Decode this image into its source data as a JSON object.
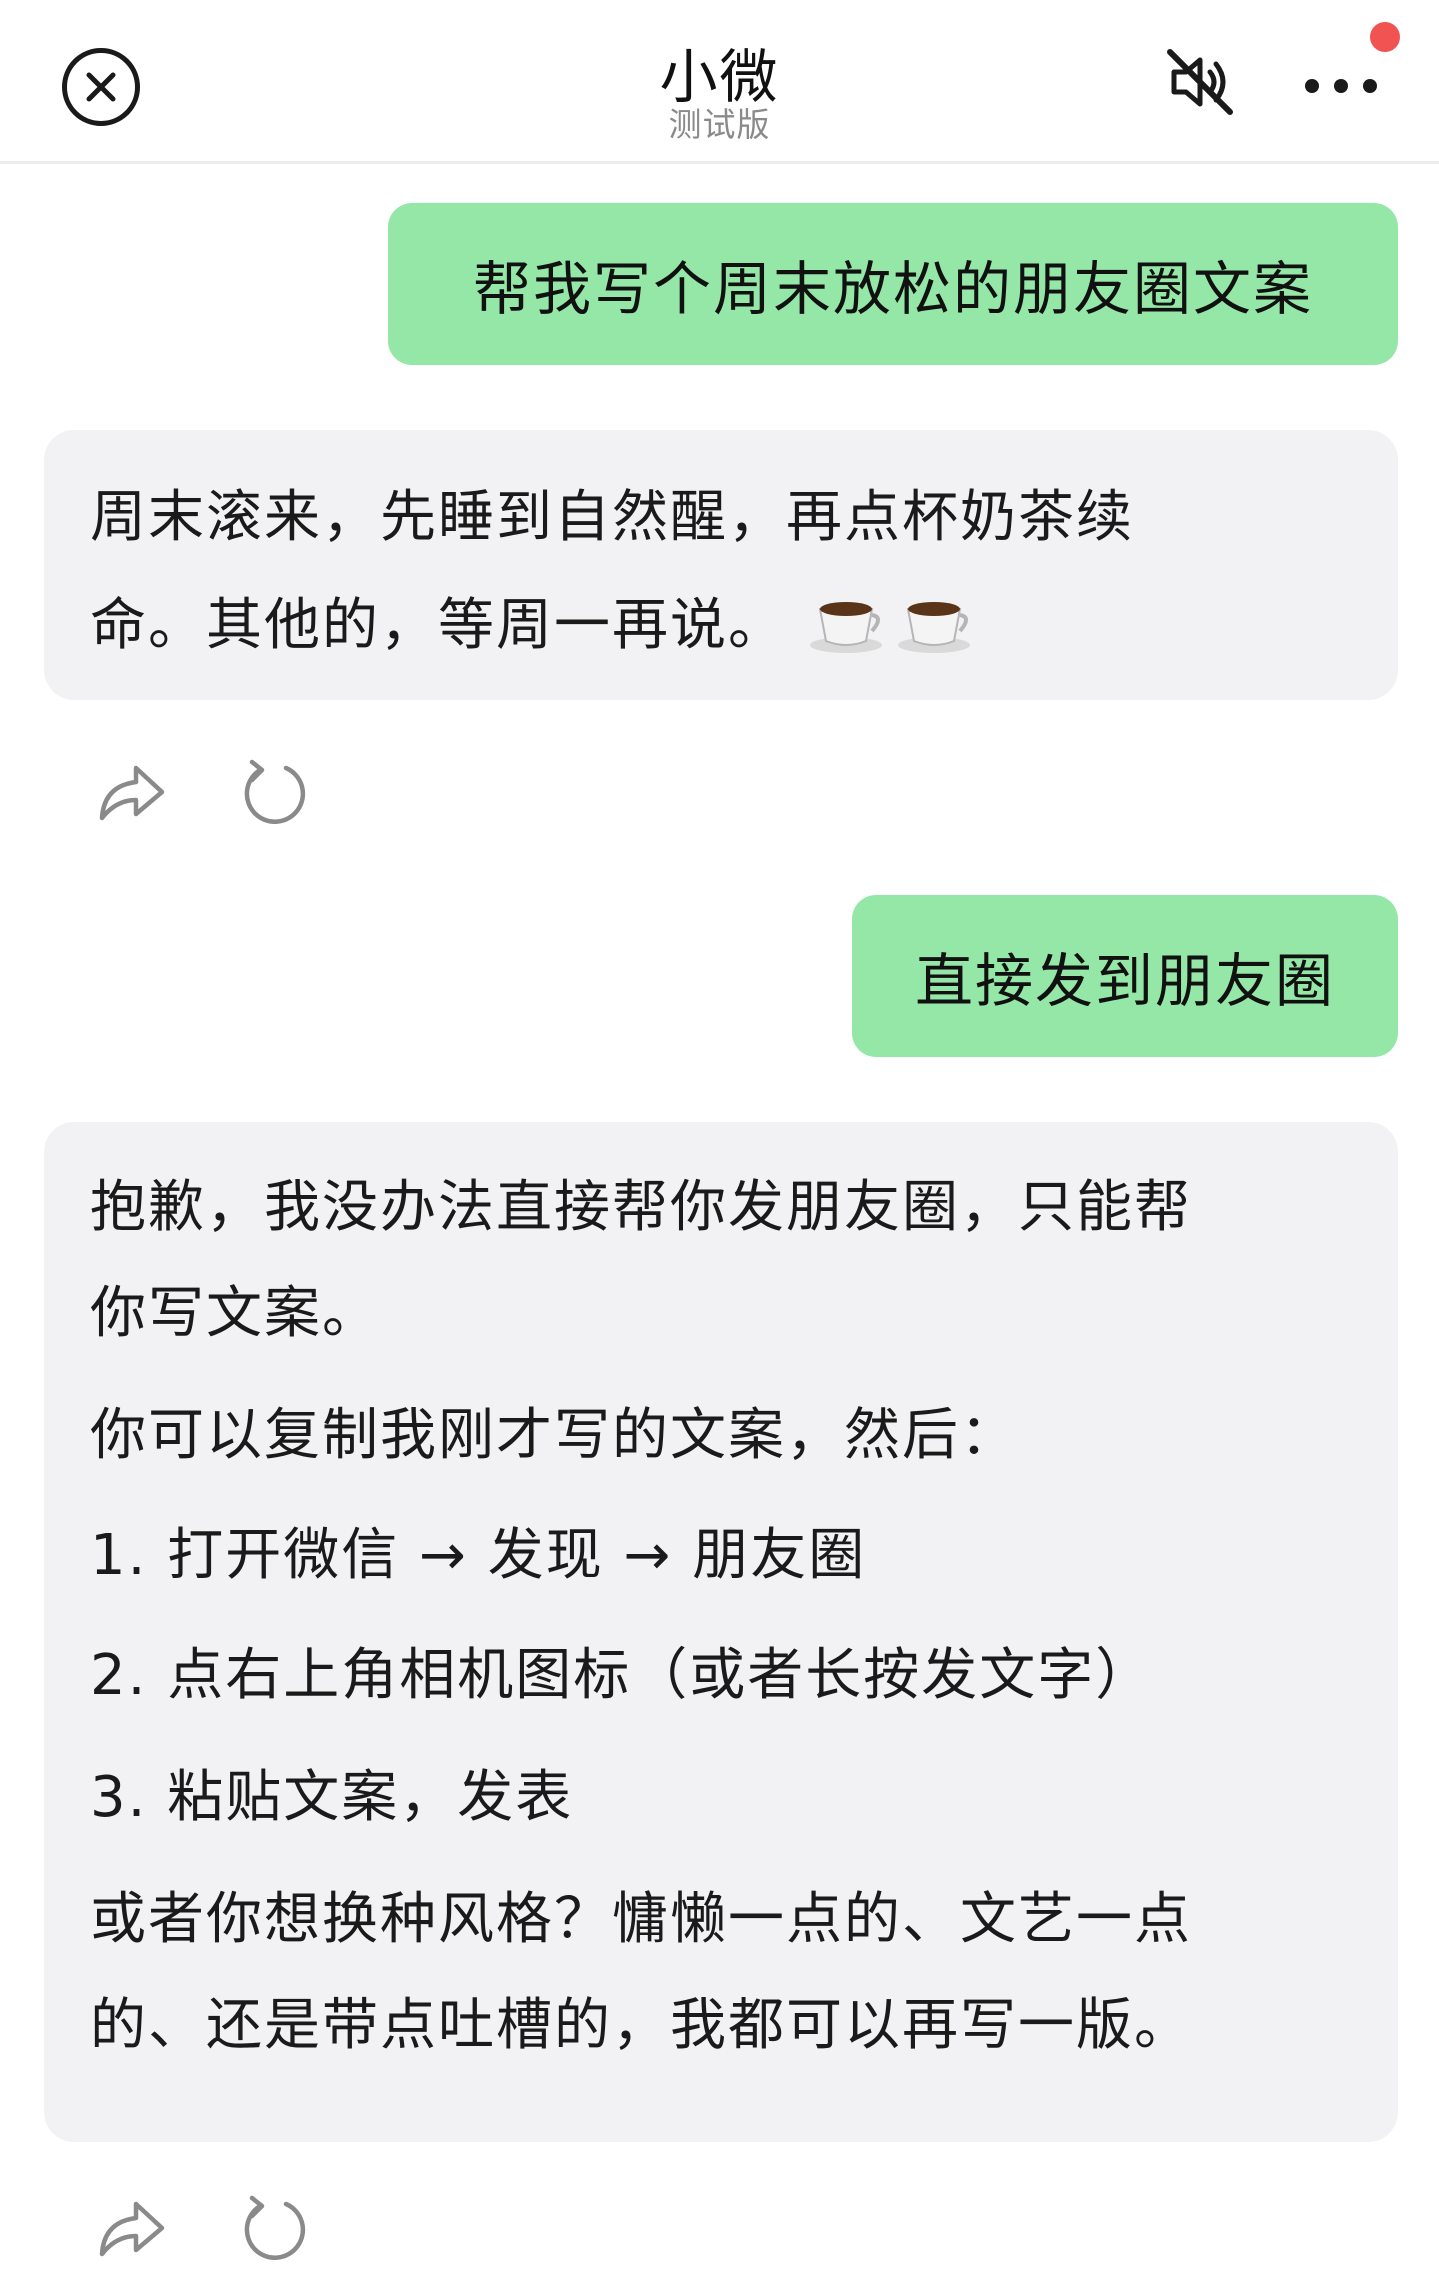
{
  "header": {
    "title": "小微",
    "subtitle": "测试版",
    "close_icon": "close-circle-icon",
    "mute_icon": "sound-off-icon",
    "more_icon": "more-dots-icon",
    "notification_color": "#f15353"
  },
  "messages": [
    {
      "role": "user",
      "text": "帮我写个周末放松的朋友圈文案"
    },
    {
      "role": "assistant",
      "lines": [
        "周末滚来，先睡到自然醒，再点杯奶茶续",
        "命。其他的，等周一再说。"
      ],
      "emoji": "☕☕"
    },
    {
      "role": "user",
      "text": "直接发到朋友圈"
    },
    {
      "role": "assistant",
      "lines": [
        "抱歉，我没办法直接帮你发朋友圈，只能帮",
        "你写文案。",
        "你可以复制我刚才写的文案，然后：",
        "1. 打开微信 → 发现 → 朋友圈",
        "2. 点右上角相机图标（或者长按发文字）",
        "3. 粘贴文案，发表",
        "或者你想换种风格？慵懒一点的、文艺一点",
        "的、还是带点吐槽的，我都可以再写一版。"
      ]
    }
  ],
  "actions": {
    "share_icon": "share-icon",
    "regenerate_icon": "refresh-icon"
  },
  "colors": {
    "user_bubble": "#95e7a7",
    "bot_bubble": "#f2f2f4"
  }
}
